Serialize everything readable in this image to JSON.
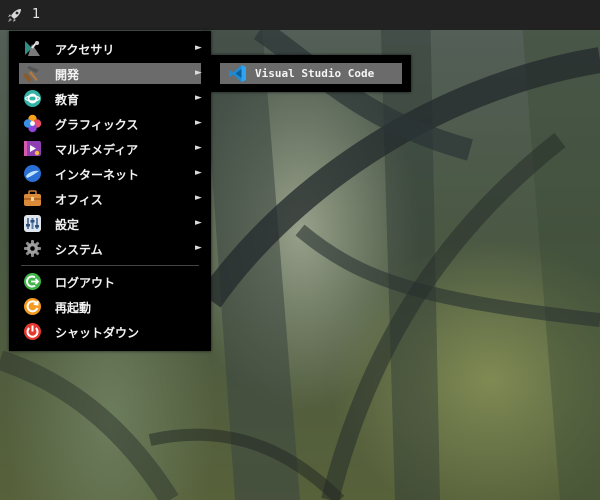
{
  "panel": {
    "workspace": "1",
    "launcher_icon": "rocket-icon"
  },
  "menu": {
    "items": [
      {
        "label": "アクセサリ",
        "icon": "accessories-icon",
        "submenu": true
      },
      {
        "label": "開発",
        "icon": "development-icon",
        "submenu": true,
        "active": true
      },
      {
        "label": "教育",
        "icon": "education-icon",
        "submenu": true
      },
      {
        "label": "グラフィックス",
        "icon": "graphics-icon",
        "submenu": true
      },
      {
        "label": "マルチメディア",
        "icon": "multimedia-icon",
        "submenu": true
      },
      {
        "label": "インターネット",
        "icon": "internet-icon",
        "submenu": true
      },
      {
        "label": "オフィス",
        "icon": "office-icon",
        "submenu": true
      },
      {
        "label": "設定",
        "icon": "settings-icon",
        "submenu": true
      },
      {
        "label": "システム",
        "icon": "system-icon",
        "submenu": true
      }
    ],
    "actions": [
      {
        "label": "ログアウト",
        "icon": "logout-icon"
      },
      {
        "label": "再起動",
        "icon": "reboot-icon"
      },
      {
        "label": "シャットダウン",
        "icon": "shutdown-icon"
      }
    ],
    "arrow": "►"
  },
  "submenu": {
    "items": [
      {
        "label": "Visual Studio Code",
        "icon": "vscode-icon"
      }
    ]
  },
  "colors": {
    "menu_bg": "#000000",
    "highlight": "#6b6b6b",
    "panel_bg": "#222222"
  }
}
